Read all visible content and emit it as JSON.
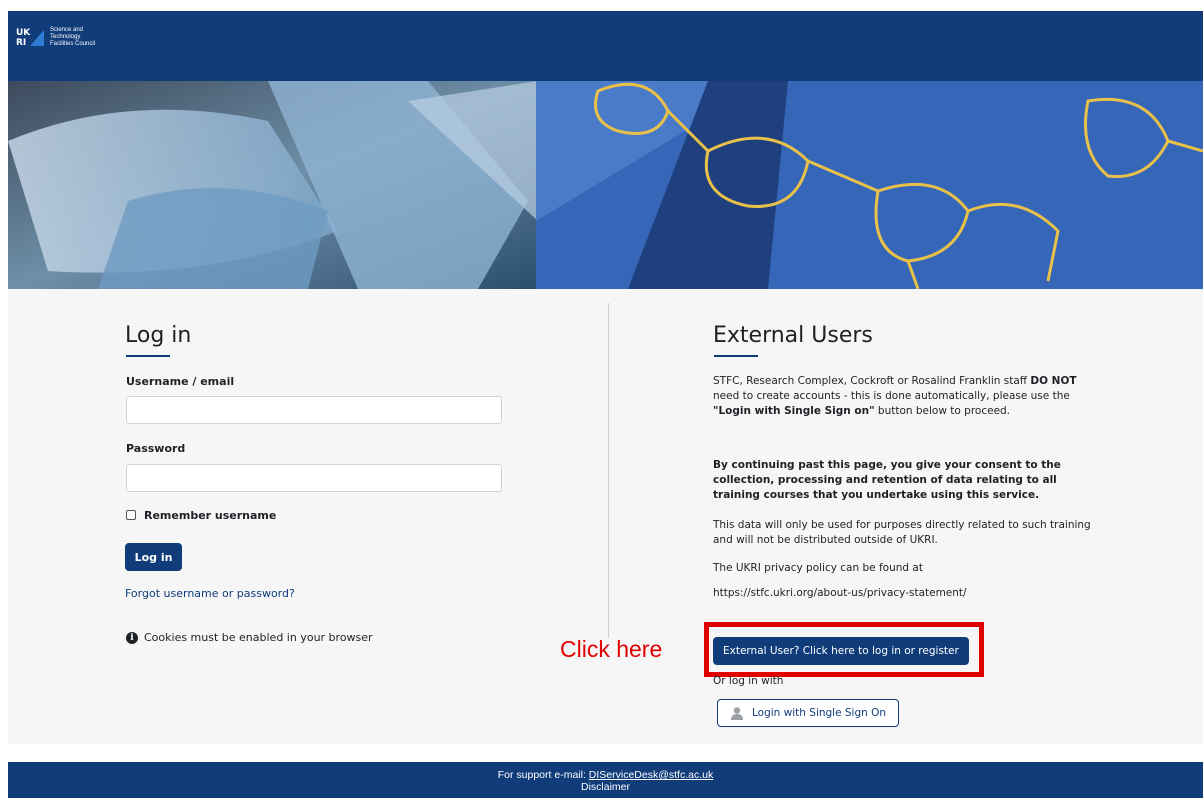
{
  "header": {
    "logo_text": "Science and\nTechnology\nFacilities Council",
    "logo_mark_text": "UK RI"
  },
  "login": {
    "title": "Log in",
    "username_label": "Username / email",
    "username_value": "",
    "password_label": "Password",
    "password_value": "",
    "remember_label": "Remember username",
    "remember_checked": false,
    "login_button": "Log in",
    "forgot_link": "Forgot username or password?",
    "cookies_notice": "Cookies must be enabled in your browser"
  },
  "external": {
    "title": "External Users",
    "para1_prefix": "STFC, Research Complex, Cockroft or Rosalind Franklin staff ",
    "para1_bold": "DO NOT",
    "para1_mid": " need to create accounts - this is done automatically, please use the ",
    "para1_bold2": "\"Login with Single Sign on\"",
    "para1_suffix": " button below to proceed.",
    "consent": "By continuing past this page, you give your consent to the collection, processing and retention of data relating to all training courses that you undertake using this service.",
    "data_use": "This data will only be used for purposes directly related to such training and will not be distributed outside of UKRI.",
    "privacy_intro": "The UKRI privacy policy can be found at",
    "privacy_link": "https://stfc.ukri.org/about-us/privacy-statement/",
    "external_button": "External User? Click here to log in or register",
    "or_log_in_with": "Or log in with",
    "sso_button": "Login with Single Sign On"
  },
  "annotation": {
    "click_here": "Click here",
    "color": "#e00000"
  },
  "footer": {
    "support_prefix": "For support e-mail: ",
    "support_email": "DIServiceDesk@stfc.ac.uk",
    "disclaimer": "Disclaimer"
  },
  "colors": {
    "brand": "#103c7a",
    "panel": "#f6f6f7"
  }
}
